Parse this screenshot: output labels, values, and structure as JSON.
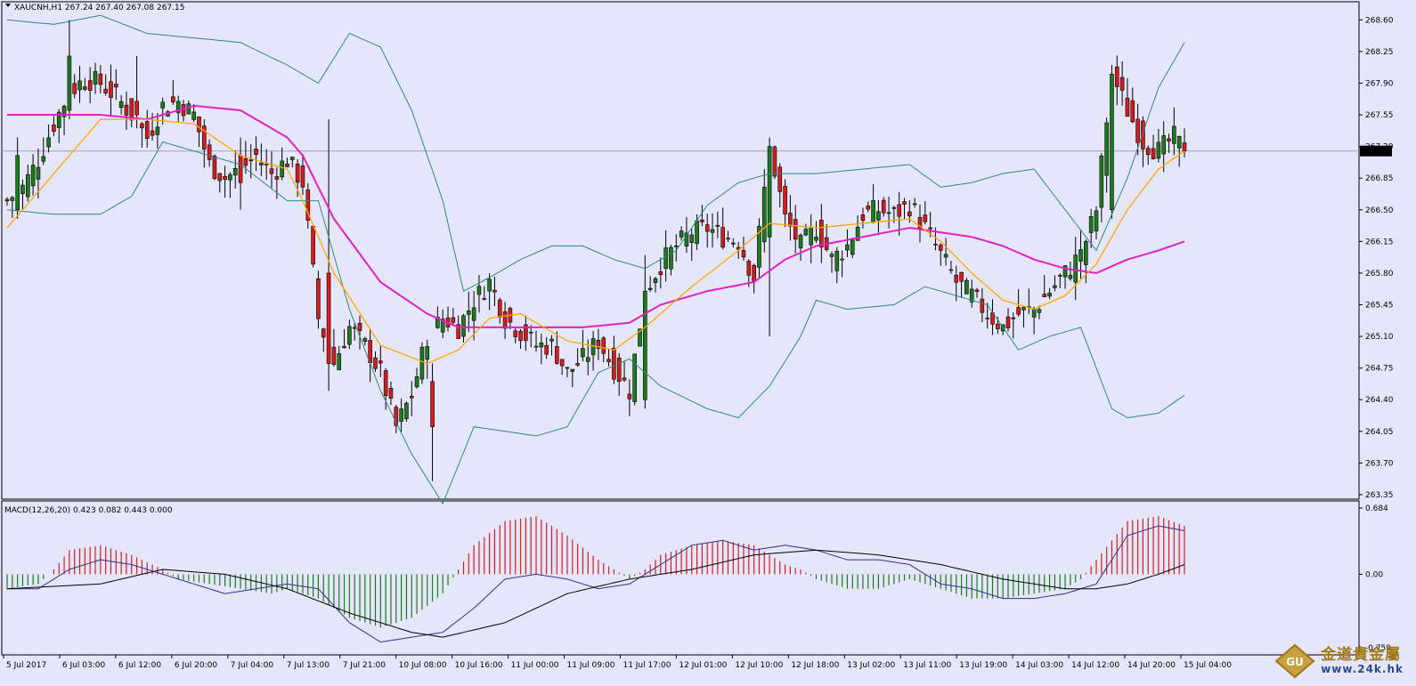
{
  "chart_data": {
    "type": "candlestick",
    "symbol": "XAUCNH,H1",
    "header_values": "267.24 267.40 267.08 267.15",
    "current_price": "267.15",
    "ylim": [
      263.3,
      268.8
    ],
    "y_ticks": [
      "268.60",
      "268.25",
      "267.90",
      "267.55",
      "267.20",
      "266.85",
      "266.50",
      "266.15",
      "265.80",
      "265.45",
      "265.10",
      "264.75",
      "264.40",
      "264.05",
      "263.70",
      "263.35"
    ],
    "x_labels": [
      "5 Jul 2017",
      "6 Jul 03:00",
      "6 Jul 12:00",
      "6 Jul 20:00",
      "7 Jul 04:00",
      "7 Jul 13:00",
      "7 Jul 21:00",
      "10 Jul 08:00",
      "10 Jul 16:00",
      "11 Jul 00:00",
      "11 Jul 09:00",
      "11 Jul 17:00",
      "12 Jul 01:00",
      "12 Jul 10:00",
      "12 Jul 18:00",
      "13 Jul 02:00",
      "13 Jul 11:00",
      "13 Jul 19:00",
      "14 Jul 03:00",
      "14 Jul 12:00",
      "14 Jul 20:00",
      "15 Jul 04:00"
    ],
    "close_path": [
      [
        0,
        266.6
      ],
      [
        3,
        266.75
      ],
      [
        6,
        267.05
      ],
      [
        9,
        267.45
      ],
      [
        12,
        267.8
      ],
      [
        15,
        267.95
      ],
      [
        18,
        267.9
      ],
      [
        21,
        267.75
      ],
      [
        24,
        267.55
      ],
      [
        27,
        267.3
      ],
      [
        30,
        267.65
      ],
      [
        33,
        267.7
      ],
      [
        36,
        267.55
      ],
      [
        39,
        267.0
      ],
      [
        42,
        266.85
      ],
      [
        45,
        266.95
      ],
      [
        48,
        267.1
      ],
      [
        51,
        266.9
      ],
      [
        54,
        267.05
      ],
      [
        57,
        266.8
      ],
      [
        60,
        265.3
      ],
      [
        63,
        264.8
      ],
      [
        66,
        265.2
      ],
      [
        69,
        265.0
      ],
      [
        72,
        264.7
      ],
      [
        75,
        264.1
      ],
      [
        78,
        264.45
      ],
      [
        81,
        265.1
      ],
      [
        84,
        265.3
      ],
      [
        87,
        265.2
      ],
      [
        90,
        265.5
      ],
      [
        93,
        265.7
      ],
      [
        96,
        265.3
      ],
      [
        99,
        265.15
      ],
      [
        102,
        265.0
      ],
      [
        105,
        265.0
      ],
      [
        108,
        264.7
      ],
      [
        111,
        264.85
      ],
      [
        114,
        265.05
      ],
      [
        117,
        264.75
      ],
      [
        120,
        264.5
      ],
      [
        123,
        265.6
      ],
      [
        126,
        265.9
      ],
      [
        129,
        266.1
      ],
      [
        132,
        266.25
      ],
      [
        135,
        266.3
      ],
      [
        138,
        266.2
      ],
      [
        141,
        266.15
      ],
      [
        144,
        265.75
      ],
      [
        147,
        267.2
      ],
      [
        150,
        266.4
      ],
      [
        153,
        266.1
      ],
      [
        156,
        266.3
      ],
      [
        159,
        265.95
      ],
      [
        162,
        266.1
      ],
      [
        165,
        266.45
      ],
      [
        168,
        266.5
      ],
      [
        171,
        266.45
      ],
      [
        174,
        266.55
      ],
      [
        177,
        266.3
      ],
      [
        180,
        266.0
      ],
      [
        183,
        265.7
      ],
      [
        186,
        265.55
      ],
      [
        189,
        265.35
      ],
      [
        192,
        265.2
      ],
      [
        195,
        265.35
      ],
      [
        198,
        265.4
      ],
      [
        201,
        265.6
      ],
      [
        204,
        265.8
      ],
      [
        207,
        266.0
      ],
      [
        210,
        266.5
      ],
      [
        213,
        268.0
      ],
      [
        216,
        267.6
      ],
      [
        219,
        267.25
      ],
      [
        222,
        267.15
      ],
      [
        225,
        267.3
      ],
      [
        227,
        267.15
      ]
    ],
    "ema_fast_path": [
      [
        0,
        266.3
      ],
      [
        9,
        266.9
      ],
      [
        18,
        267.5
      ],
      [
        27,
        267.5
      ],
      [
        36,
        267.45
      ],
      [
        45,
        267.1
      ],
      [
        54,
        266.95
      ],
      [
        57,
        266.6
      ],
      [
        63,
        265.8
      ],
      [
        72,
        265.0
      ],
      [
        81,
        264.8
      ],
      [
        87,
        264.95
      ],
      [
        93,
        265.3
      ],
      [
        99,
        265.35
      ],
      [
        108,
        265.05
      ],
      [
        117,
        264.95
      ],
      [
        123,
        265.2
      ],
      [
        132,
        265.65
      ],
      [
        141,
        266.05
      ],
      [
        147,
        266.35
      ],
      [
        156,
        266.3
      ],
      [
        165,
        266.35
      ],
      [
        174,
        266.4
      ],
      [
        180,
        266.15
      ],
      [
        186,
        265.8
      ],
      [
        192,
        265.5
      ],
      [
        198,
        265.4
      ],
      [
        204,
        265.55
      ],
      [
        210,
        265.9
      ],
      [
        216,
        266.5
      ],
      [
        222,
        266.95
      ],
      [
        227,
        267.15
      ]
    ],
    "ma_slow_path": [
      [
        0,
        267.55
      ],
      [
        18,
        267.55
      ],
      [
        27,
        267.5
      ],
      [
        36,
        267.65
      ],
      [
        45,
        267.6
      ],
      [
        54,
        267.3
      ],
      [
        57,
        267.1
      ],
      [
        63,
        266.4
      ],
      [
        72,
        265.7
      ],
      [
        81,
        265.35
      ],
      [
        87,
        265.2
      ],
      [
        93,
        265.2
      ],
      [
        102,
        265.2
      ],
      [
        111,
        265.2
      ],
      [
        120,
        265.25
      ],
      [
        126,
        265.45
      ],
      [
        135,
        265.6
      ],
      [
        144,
        265.7
      ],
      [
        150,
        265.95
      ],
      [
        156,
        266.1
      ],
      [
        165,
        266.2
      ],
      [
        174,
        266.3
      ],
      [
        180,
        266.25
      ],
      [
        186,
        266.2
      ],
      [
        192,
        266.1
      ],
      [
        198,
        265.95
      ],
      [
        204,
        265.85
      ],
      [
        210,
        265.8
      ],
      [
        216,
        265.95
      ],
      [
        222,
        266.05
      ],
      [
        227,
        266.15
      ]
    ],
    "bb_upper_path": [
      [
        0,
        268.6
      ],
      [
        9,
        268.55
      ],
      [
        18,
        268.65
      ],
      [
        27,
        268.45
      ],
      [
        36,
        268.4
      ],
      [
        45,
        268.35
      ],
      [
        54,
        268.1
      ],
      [
        60,
        267.9
      ],
      [
        66,
        268.45
      ],
      [
        72,
        268.3
      ],
      [
        78,
        267.6
      ],
      [
        84,
        266.6
      ],
      [
        88,
        265.6
      ],
      [
        93,
        265.75
      ],
      [
        99,
        265.95
      ],
      [
        105,
        266.1
      ],
      [
        111,
        266.1
      ],
      [
        117,
        265.95
      ],
      [
        123,
        265.85
      ],
      [
        129,
        266.05
      ],
      [
        135,
        266.55
      ],
      [
        141,
        266.8
      ],
      [
        147,
        266.9
      ],
      [
        156,
        266.9
      ],
      [
        165,
        266.95
      ],
      [
        174,
        267.0
      ],
      [
        180,
        266.75
      ],
      [
        186,
        266.8
      ],
      [
        192,
        266.9
      ],
      [
        198,
        266.95
      ],
      [
        204,
        266.5
      ],
      [
        210,
        266.05
      ],
      [
        216,
        266.85
      ],
      [
        222,
        267.85
      ],
      [
        227,
        268.35
      ]
    ],
    "bb_lower_path": [
      [
        0,
        266.5
      ],
      [
        9,
        266.45
      ],
      [
        18,
        266.45
      ],
      [
        24,
        266.65
      ],
      [
        30,
        267.25
      ],
      [
        36,
        267.15
      ],
      [
        45,
        267.0
      ],
      [
        54,
        266.6
      ],
      [
        60,
        266.6
      ],
      [
        66,
        265.4
      ],
      [
        72,
        264.5
      ],
      [
        78,
        263.8
      ],
      [
        84,
        263.25
      ],
      [
        90,
        264.1
      ],
      [
        96,
        264.05
      ],
      [
        102,
        264.0
      ],
      [
        108,
        264.1
      ],
      [
        114,
        264.7
      ],
      [
        120,
        264.85
      ],
      [
        126,
        264.55
      ],
      [
        135,
        264.3
      ],
      [
        141,
        264.2
      ],
      [
        147,
        264.55
      ],
      [
        153,
        265.1
      ],
      [
        156,
        265.5
      ],
      [
        162,
        265.4
      ],
      [
        171,
        265.45
      ],
      [
        177,
        265.65
      ],
      [
        183,
        265.55
      ],
      [
        189,
        265.45
      ],
      [
        195,
        264.95
      ],
      [
        201,
        265.1
      ],
      [
        207,
        265.2
      ],
      [
        213,
        264.3
      ],
      [
        216,
        264.2
      ],
      [
        222,
        264.25
      ],
      [
        227,
        264.45
      ]
    ],
    "candles_sample": [
      {
        "i": 2,
        "o": 266.5,
        "h": 267.3,
        "l": 266.4,
        "c": 267.1
      },
      {
        "i": 12,
        "o": 267.6,
        "h": 268.6,
        "l": 267.5,
        "c": 268.2
      },
      {
        "i": 25,
        "o": 267.7,
        "h": 268.2,
        "l": 267.4,
        "c": 267.55
      },
      {
        "i": 45,
        "o": 267.1,
        "h": 267.3,
        "l": 266.5,
        "c": 266.8
      },
      {
        "i": 62,
        "o": 265.8,
        "h": 267.5,
        "l": 264.5,
        "c": 264.8
      },
      {
        "i": 82,
        "o": 264.6,
        "h": 264.8,
        "l": 263.5,
        "c": 264.1
      },
      {
        "i": 123,
        "o": 264.4,
        "h": 266.0,
        "l": 264.3,
        "c": 265.6
      },
      {
        "i": 147,
        "o": 266.2,
        "h": 267.3,
        "l": 265.1,
        "c": 267.2
      },
      {
        "i": 206,
        "o": 265.7,
        "h": 266.2,
        "l": 265.5,
        "c": 266.0
      },
      {
        "i": 213,
        "o": 266.5,
        "h": 268.1,
        "l": 266.4,
        "c": 268.0
      },
      {
        "i": 227,
        "o": 267.24,
        "h": 267.4,
        "l": 267.08,
        "c": 267.15
      }
    ],
    "macd": {
      "label": "MACD(12,26,20) 0.423 0.082 0.443 0.000",
      "ylim": [
        -0.759,
        0.684
      ],
      "y_ticks": [
        "0.684",
        "0.00",
        "-0.759"
      ],
      "hist_path": [
        [
          0,
          -0.15
        ],
        [
          6,
          -0.1
        ],
        [
          9,
          0.05
        ],
        [
          12,
          0.25
        ],
        [
          18,
          0.3
        ],
        [
          24,
          0.2
        ],
        [
          30,
          0.05
        ],
        [
          33,
          -0.05
        ],
        [
          39,
          -0.1
        ],
        [
          45,
          -0.15
        ],
        [
          51,
          -0.2
        ],
        [
          54,
          -0.15
        ],
        [
          60,
          -0.25
        ],
        [
          66,
          -0.45
        ],
        [
          72,
          -0.55
        ],
        [
          78,
          -0.45
        ],
        [
          84,
          -0.2
        ],
        [
          87,
          0.05
        ],
        [
          90,
          0.3
        ],
        [
          96,
          0.55
        ],
        [
          102,
          0.6
        ],
        [
          108,
          0.4
        ],
        [
          114,
          0.15
        ],
        [
          117,
          0.05
        ],
        [
          120,
          -0.05
        ],
        [
          123,
          0.05
        ],
        [
          126,
          0.2
        ],
        [
          132,
          0.3
        ],
        [
          138,
          0.35
        ],
        [
          144,
          0.3
        ],
        [
          150,
          0.1
        ],
        [
          153,
          0.05
        ],
        [
          156,
          -0.05
        ],
        [
          162,
          -0.15
        ],
        [
          168,
          -0.15
        ],
        [
          174,
          -0.05
        ],
        [
          180,
          -0.15
        ],
        [
          186,
          -0.25
        ],
        [
          192,
          -0.25
        ],
        [
          198,
          -0.2
        ],
        [
          204,
          -0.15
        ],
        [
          207,
          -0.05
        ],
        [
          210,
          0.15
        ],
        [
          216,
          0.55
        ],
        [
          222,
          0.6
        ],
        [
          227,
          0.5
        ]
      ],
      "macd_path": [
        [
          0,
          -0.15
        ],
        [
          6,
          -0.15
        ],
        [
          12,
          0.05
        ],
        [
          18,
          0.15
        ],
        [
          24,
          0.1
        ],
        [
          30,
          0.0
        ],
        [
          36,
          -0.1
        ],
        [
          42,
          -0.2
        ],
        [
          48,
          -0.15
        ],
        [
          54,
          -0.1
        ],
        [
          60,
          -0.15
        ],
        [
          66,
          -0.5
        ],
        [
          72,
          -0.7
        ],
        [
          78,
          -0.65
        ],
        [
          84,
          -0.6
        ],
        [
          90,
          -0.35
        ],
        [
          96,
          -0.05
        ],
        [
          102,
          0.0
        ],
        [
          108,
          -0.05
        ],
        [
          114,
          -0.15
        ],
        [
          120,
          -0.1
        ],
        [
          126,
          0.1
        ],
        [
          132,
          0.3
        ],
        [
          138,
          0.35
        ],
        [
          144,
          0.25
        ],
        [
          150,
          0.3
        ],
        [
          156,
          0.25
        ],
        [
          162,
          0.15
        ],
        [
          168,
          0.15
        ],
        [
          174,
          0.1
        ],
        [
          180,
          -0.1
        ],
        [
          186,
          -0.15
        ],
        [
          192,
          -0.25
        ],
        [
          198,
          -0.25
        ],
        [
          204,
          -0.2
        ],
        [
          210,
          -0.1
        ],
        [
          216,
          0.4
        ],
        [
          222,
          0.5
        ],
        [
          227,
          0.45
        ]
      ],
      "signal_path": [
        [
          0,
          -0.15
        ],
        [
          18,
          -0.1
        ],
        [
          30,
          0.05
        ],
        [
          42,
          0.0
        ],
        [
          54,
          -0.15
        ],
        [
          66,
          -0.4
        ],
        [
          78,
          -0.6
        ],
        [
          84,
          -0.65
        ],
        [
          96,
          -0.5
        ],
        [
          108,
          -0.2
        ],
        [
          120,
          -0.05
        ],
        [
          132,
          0.05
        ],
        [
          144,
          0.2
        ],
        [
          156,
          0.25
        ],
        [
          168,
          0.2
        ],
        [
          180,
          0.1
        ],
        [
          192,
          -0.05
        ],
        [
          204,
          -0.15
        ],
        [
          210,
          -0.15
        ],
        [
          216,
          -0.1
        ],
        [
          222,
          0.0
        ],
        [
          227,
          0.1
        ]
      ]
    },
    "colors": {
      "background": "#e6e6fa",
      "candle_up": "#1e7a1e",
      "candle_down": "#d41e1e",
      "ema_fast": "#ffa500",
      "ma_slow": "#e020c8",
      "bbands": "#2a8a7a",
      "macd_line": "#303090",
      "signal_line": "#000000",
      "hist_pos": "#d41e1e",
      "hist_neg": "#1e7a1e"
    }
  },
  "watermark": {
    "logo_text": "GU",
    "cn_text": "金道貴金屬",
    "url_text": "www.24k.hk"
  }
}
